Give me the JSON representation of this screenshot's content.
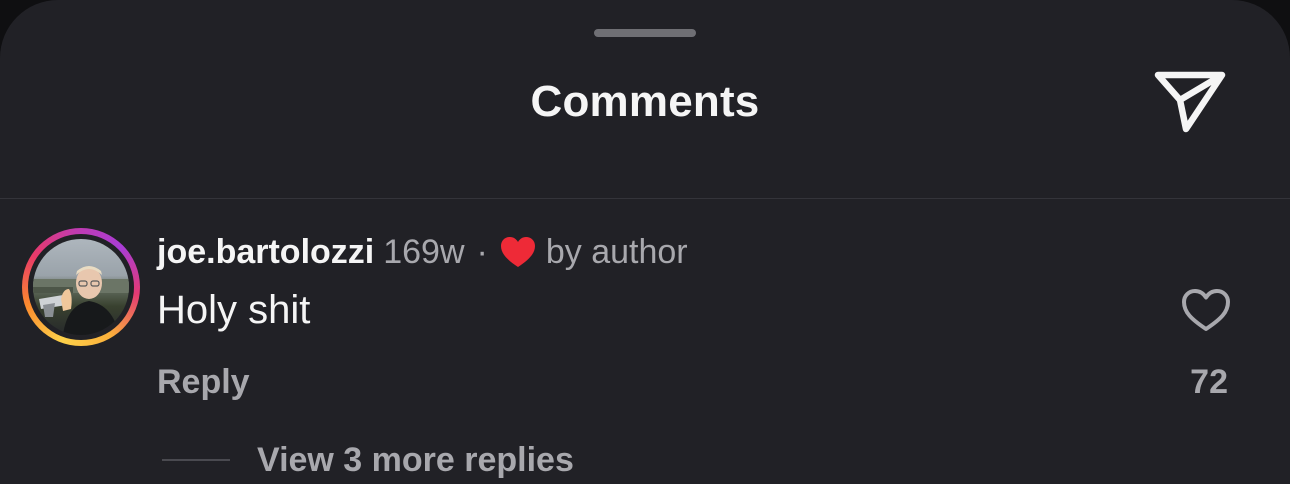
{
  "header": {
    "title": "Comments",
    "share_icon": "paper-plane-icon"
  },
  "comment": {
    "username": "joe.bartolozzi",
    "age": "169w",
    "separator": "·",
    "liked_by_author_icon": "heart-filled-icon",
    "liked_by_author_label": "by author",
    "text": "Holy shit",
    "like_icon": "heart-outline-icon",
    "like_count": "72",
    "reply_label": "Reply",
    "view_replies_label": "View 3 more replies"
  },
  "colors": {
    "sheet_background": "#212126",
    "primary_text": "#f5f5f5",
    "secondary_text": "#a8a8ad",
    "author_heart": "#ee2a37"
  }
}
